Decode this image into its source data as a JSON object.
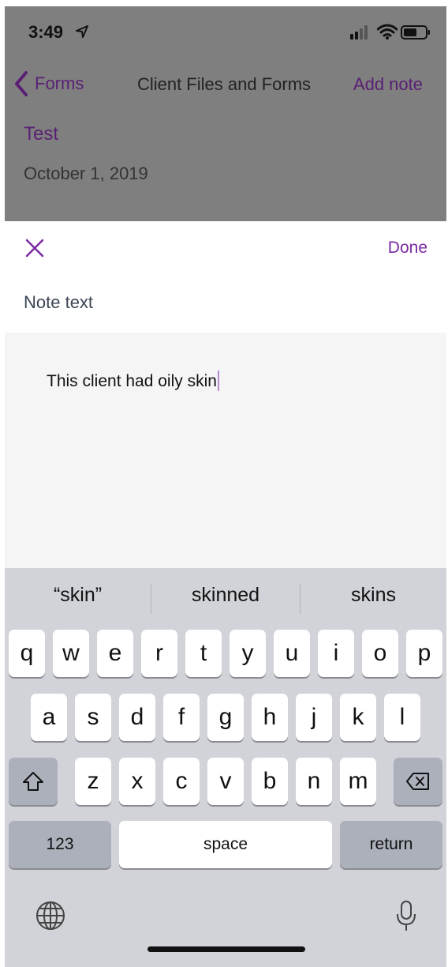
{
  "status_bar": {
    "time": "3:49"
  },
  "nav": {
    "back_label": "Forms",
    "title": "Client Files and Forms",
    "add_label": "Add note"
  },
  "note": {
    "title": "Test",
    "date": "October 1, 2019"
  },
  "modal": {
    "done_label": "Done",
    "field_label": "Note text",
    "text_value": "This client had oily skin"
  },
  "keyboard": {
    "suggestions": [
      "“skin”",
      "skinned",
      "skins"
    ],
    "row1": [
      "q",
      "w",
      "e",
      "r",
      "t",
      "y",
      "u",
      "i",
      "o",
      "p"
    ],
    "row2": [
      "a",
      "s",
      "d",
      "f",
      "g",
      "h",
      "j",
      "k",
      "l"
    ],
    "row3": [
      "z",
      "x",
      "c",
      "v",
      "b",
      "n",
      "m"
    ],
    "numbers_label": "123",
    "space_label": "space",
    "return_label": "return"
  },
  "colors": {
    "accent": "#5a1f74",
    "accent_light": "#7a2aa2",
    "dim": "#7f7f7f",
    "keyboard_bg": "#d1d3d9"
  }
}
